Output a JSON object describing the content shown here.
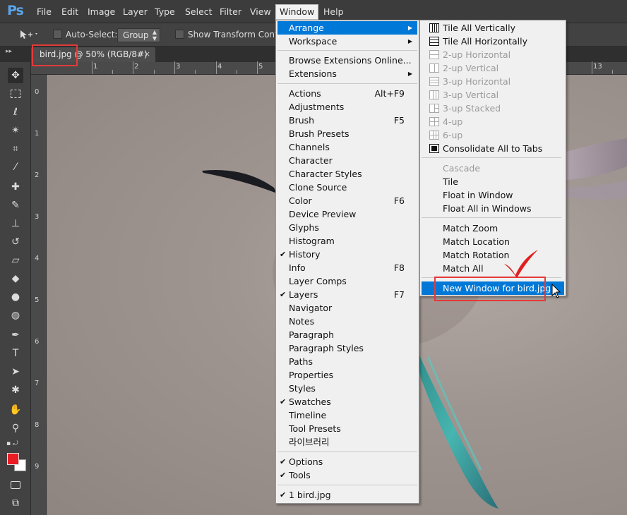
{
  "app": {
    "logo": "Ps",
    "menus": [
      "File",
      "Edit",
      "Image",
      "Layer",
      "Type",
      "Select",
      "Filter",
      "View",
      "Window",
      "Help"
    ]
  },
  "options_bar": {
    "auto_select_label": "Auto-Select:",
    "auto_select_value": "Group",
    "show_transform_label": "Show Transform Controls"
  },
  "document": {
    "tab_label": "bird.jpg @ 50% (RGB/8#)",
    "close_glyph": "×"
  },
  "rulers": {
    "top": [
      "1",
      "2",
      "3",
      "4",
      "5",
      "13"
    ],
    "left": [
      "0",
      "1",
      "2",
      "3",
      "4",
      "5",
      "6",
      "7",
      "8",
      "9"
    ]
  },
  "window_menu": {
    "items": [
      {
        "label": "Arrange",
        "submenu": true,
        "highlighted": true
      },
      {
        "label": "Workspace",
        "submenu": true
      },
      {
        "label": "Browse Extensions Online..."
      },
      {
        "label": "Extensions",
        "submenu": true
      },
      {
        "label": "Actions",
        "shortcut": "Alt+F9"
      },
      {
        "label": "Adjustments"
      },
      {
        "label": "Brush",
        "shortcut": "F5"
      },
      {
        "label": "Brush Presets"
      },
      {
        "label": "Channels"
      },
      {
        "label": "Character"
      },
      {
        "label": "Character Styles"
      },
      {
        "label": "Clone Source"
      },
      {
        "label": "Color",
        "shortcut": "F6"
      },
      {
        "label": "Device Preview"
      },
      {
        "label": "Glyphs"
      },
      {
        "label": "Histogram"
      },
      {
        "label": "History",
        "checked": true
      },
      {
        "label": "Info",
        "shortcut": "F8"
      },
      {
        "label": "Layer Comps"
      },
      {
        "label": "Layers",
        "shortcut": "F7",
        "checked": true
      },
      {
        "label": "Navigator"
      },
      {
        "label": "Notes"
      },
      {
        "label": "Paragraph"
      },
      {
        "label": "Paragraph Styles"
      },
      {
        "label": "Paths"
      },
      {
        "label": "Properties"
      },
      {
        "label": "Styles"
      },
      {
        "label": "Swatches",
        "checked": true
      },
      {
        "label": "Timeline"
      },
      {
        "label": "Tool Presets"
      },
      {
        "label": "라이브러리"
      },
      {
        "label": "Options",
        "checked": true
      },
      {
        "label": "Tools",
        "checked": true
      },
      {
        "label": "1 bird.jpg",
        "checked": true
      }
    ]
  },
  "arrange_menu": {
    "items": [
      {
        "label": "Tile All Vertically",
        "icon": "tile-vertical-icon"
      },
      {
        "label": "Tile All Horizontally",
        "icon": "tile-horizontal-icon"
      },
      {
        "label": "2-up Horizontal",
        "icon": "two-up-horizontal-icon",
        "disabled": true
      },
      {
        "label": "2-up Vertical",
        "icon": "two-up-vertical-icon",
        "disabled": true
      },
      {
        "label": "3-up Horizontal",
        "icon": "three-up-horizontal-icon",
        "disabled": true
      },
      {
        "label": "3-up Vertical",
        "icon": "three-up-vertical-icon",
        "disabled": true
      },
      {
        "label": "3-up Stacked",
        "icon": "three-up-stacked-icon",
        "disabled": true
      },
      {
        "label": "4-up",
        "icon": "four-up-icon",
        "disabled": true
      },
      {
        "label": "6-up",
        "icon": "six-up-icon",
        "disabled": true
      },
      {
        "label": "Consolidate All to Tabs",
        "icon": "consolidate-tabs-icon"
      },
      {
        "label": "Cascade",
        "disabled": true
      },
      {
        "label": "Tile"
      },
      {
        "label": "Float in Window"
      },
      {
        "label": "Float All in Windows"
      },
      {
        "label": "Match Zoom"
      },
      {
        "label": "Match Location"
      },
      {
        "label": "Match Rotation"
      },
      {
        "label": "Match All"
      },
      {
        "label": "New Window for bird.jpg",
        "highlighted": true
      }
    ]
  },
  "colors": {
    "foreground": "#ea1c24",
    "background": "#ffffff",
    "menu_highlight": "#0078d7",
    "annotation": "#e33a3a"
  }
}
